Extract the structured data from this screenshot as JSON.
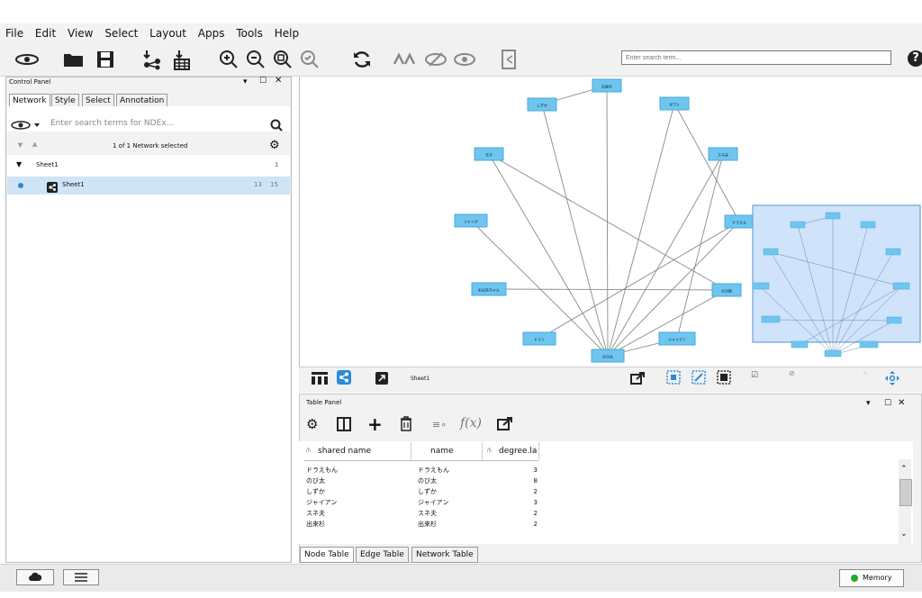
{
  "menu": [
    "File",
    "Edit",
    "View",
    "Select",
    "Layout",
    "Apps",
    "Tools",
    "Help"
  ],
  "toolbar": {
    "icons": [
      "ndex-icon",
      "open-folder-icon",
      "save-icon",
      "import-network-icon",
      "import-table-icon",
      "zoom-in-icon",
      "zoom-out-icon",
      "zoom-fit-icon",
      "zoom-selected-icon",
      "refresh-icon",
      "hide-icon",
      "show-icon",
      "eye-icon",
      "export-icon"
    ],
    "search_placeholder": "Enter search term..."
  },
  "control_panel": {
    "title": "Control Panel",
    "tabs": [
      "Network",
      "Style",
      "Select",
      "Annotation"
    ],
    "ndex_search_placeholder": "Enter search terms for NDEx...",
    "selection_status": "1 of 1 Network selected",
    "collection_name": "Sheet1",
    "collection_count": "1",
    "network_name": "Sheet1",
    "network_nodes": "13",
    "network_edges": "15"
  },
  "network": {
    "nodes": [
      {
        "id": "n1",
        "label": "出来杉"
      },
      {
        "id": "n2",
        "label": "しずか"
      },
      {
        "id": "n3",
        "label": "セワシ"
      },
      {
        "id": "n4",
        "label": "玉子"
      },
      {
        "id": "n5",
        "label": "スネ夫"
      },
      {
        "id": "n6",
        "label": "ジャイ子"
      },
      {
        "id": "n7",
        "label": "ドラえも"
      },
      {
        "id": "n8",
        "label": "おばあちゃん"
      },
      {
        "id": "n9",
        "label": "のび助"
      },
      {
        "id": "n10",
        "label": "ドラミ"
      },
      {
        "id": "n11",
        "label": "ジャイアン"
      },
      {
        "id": "n12",
        "label": "のび太"
      }
    ],
    "view_title": "Sheet1"
  },
  "table_panel": {
    "title": "Table Panel",
    "columns": [
      "shared name",
      "name",
      "degree.la"
    ],
    "rows": [
      [
        "ドラえもん",
        "ドラえもん",
        "3"
      ],
      [
        "のび太",
        "のび太",
        "8"
      ],
      [
        "しずか",
        "しずか",
        "2"
      ],
      [
        "ジャイアン",
        "ジャイアン",
        "3"
      ],
      [
        "スネ夫",
        "スネ夫",
        "2"
      ],
      [
        "出来杉",
        "出来杉",
        "2"
      ]
    ],
    "bottom_tabs": [
      "Node Table",
      "Edge Table",
      "Network Table"
    ]
  },
  "status": {
    "memory_label": "Memory",
    "memory_color": "#27a829"
  },
  "colors": {
    "node_fill": "#6ec6f0",
    "node_border": "#4aa8d8",
    "overview_fill": "#cfe3fb",
    "selection_blue": "#cfe4f7"
  }
}
